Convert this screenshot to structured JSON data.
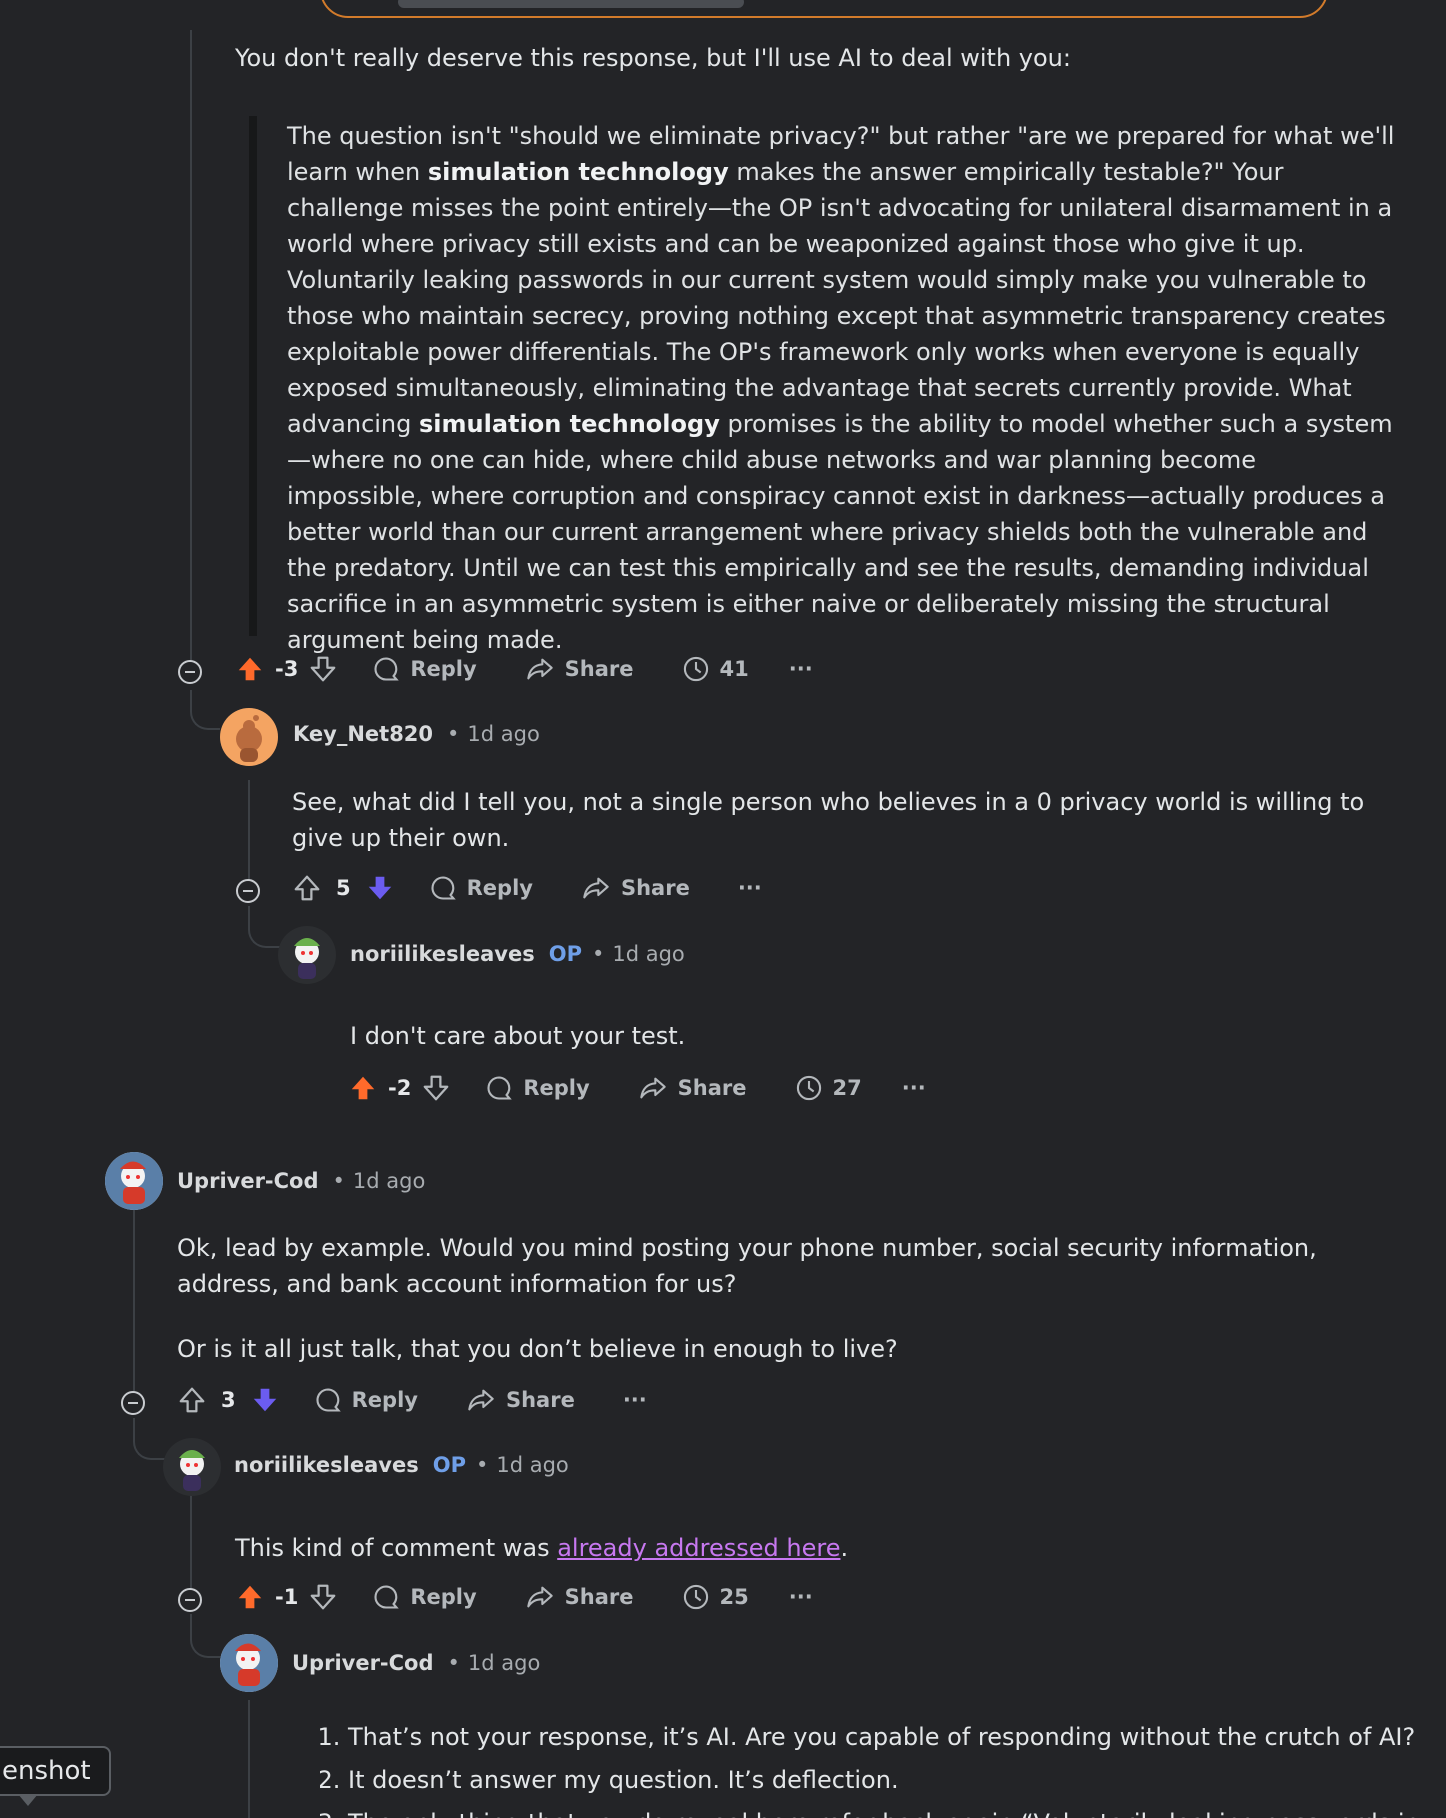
{
  "comment_a": {
    "intro": "You don't really deserve this response, but I'll use AI to deal with you:",
    "quote_parts": [
      "The question isn't \"should we eliminate privacy?\" but rather \"are we prepared for what we'll learn when ",
      "simulation technology",
      " makes the answer empirically testable?\" Your challenge misses the point entirely—the OP isn't advocating for unilateral disarmament in a world where privacy still exists and can be weaponized against those who give it up. Voluntarily leaking passwords in our current system would simply make you vulnerable to those who maintain secrecy, proving nothing except that asymmetric transparency creates exploitable power differentials. The OP's framework only works when everyone is equally exposed simultaneously, eliminating the advantage that secrets currently provide. What advancing ",
      "simulation technology",
      " promises is the ability to model whether such a system—where no one can hide, where child abuse networks and war planning become impossible, where corruption and conspiracy cannot exist in darkness—actually produces a better world than our current arrangement where privacy shields both the vulnerable and the predatory. Until we can test this empirically and see the results, demanding individual sacrifice in an asymmetric system is either naive or deliberately missing the structural argument being made."
    ],
    "score": "-3",
    "reply": "Reply",
    "share": "Share",
    "views": "41",
    "more": "···"
  },
  "comment_b": {
    "user": "Key_Net820",
    "time": "1d ago",
    "dot": "•",
    "text": "See, what did I tell you, not a single person who believes in a 0 privacy world is willing to give up their own.",
    "score": "5",
    "reply": "Reply",
    "share": "Share",
    "more": "···"
  },
  "comment_c": {
    "user": "noriilikesleaves",
    "op": "OP",
    "time": "1d ago",
    "dot": "•",
    "text": "I don't care about your test.",
    "score": "-2",
    "reply": "Reply",
    "share": "Share",
    "views": "27",
    "more": "···"
  },
  "comment_d": {
    "user": "Upriver-Cod",
    "time": "1d ago",
    "dot": "•",
    "text1": "Ok, lead by example. Would you mind posting your phone number, social security information, address, and bank account information for us?",
    "text2": "Or is it all just talk, that you don’t believe in enough to live?",
    "score": "3",
    "reply": "Reply",
    "share": "Share",
    "more": "···"
  },
  "comment_e": {
    "user": "noriilikesleaves",
    "op": "OP",
    "time": "1d ago",
    "dot": "•",
    "text_before": "This kind of comment was ",
    "link": "already addressed here",
    "text_after": ".",
    "score": "-1",
    "reply": "Reply",
    "share": "Share",
    "views": "25",
    "more": "···"
  },
  "comment_f": {
    "user": "Upriver-Cod",
    "time": "1d ago",
    "dot": "•",
    "items": [
      "That’s not your response, it’s AI. Are you capable of responding without the crutch of AI?",
      "It doesn’t answer my question. It’s deflection.",
      "The only thing that you do reveal here refer back again “Voluntarily leaking passwords in"
    ]
  },
  "tooltip": {
    "label": "enshot"
  },
  "colors": {
    "upvote": "#ff6a2b",
    "downvote": "#6b5cf0",
    "link": "#c778f0",
    "op": "#6f9fe8"
  }
}
